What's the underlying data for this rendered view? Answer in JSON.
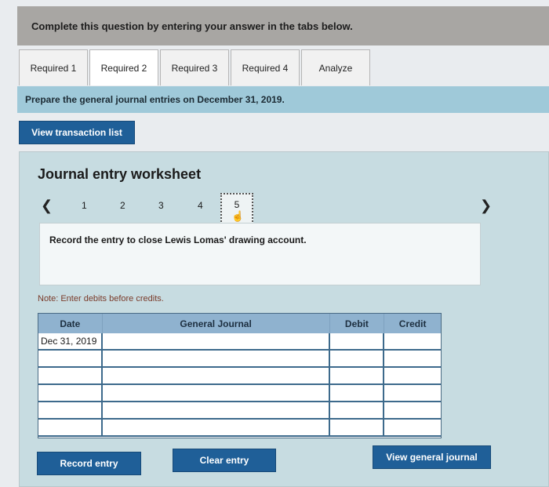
{
  "banner": {
    "text": "Complete this question by entering your answer in the tabs below."
  },
  "tabs": [
    {
      "label": "Required 1",
      "active": false
    },
    {
      "label": "Required 2",
      "active": true
    },
    {
      "label": "Required 3",
      "active": false
    },
    {
      "label": "Required 4",
      "active": false
    },
    {
      "label": "Analyze",
      "active": false
    }
  ],
  "instruction": "Prepare the general journal entries on December 31, 2019.",
  "buttons": {
    "view_transactions": "View transaction list",
    "record": "Record entry",
    "clear": "Clear entry",
    "view_journal": "View general journal"
  },
  "worksheet": {
    "title": "Journal entry worksheet",
    "prev_icon": "chevron-left-icon",
    "next_icon": "chevron-right-icon",
    "pages": [
      "1",
      "2",
      "3",
      "4",
      "5"
    ],
    "active_page": "5",
    "entry_prompt": "Record the entry to close Lewis Lomas' drawing account.",
    "note": "Note: Enter debits before credits."
  },
  "journal": {
    "headers": {
      "date": "Date",
      "account": "General Journal",
      "debit": "Debit",
      "credit": "Credit"
    },
    "rows": [
      {
        "date": "Dec 31, 2019",
        "account": "",
        "debit": "",
        "credit": ""
      },
      {
        "date": "",
        "account": "",
        "debit": "",
        "credit": ""
      },
      {
        "date": "",
        "account": "",
        "debit": "",
        "credit": ""
      },
      {
        "date": "",
        "account": "",
        "debit": "",
        "credit": ""
      },
      {
        "date": "",
        "account": "",
        "debit": "",
        "credit": ""
      },
      {
        "date": "",
        "account": "",
        "debit": "",
        "credit": ""
      }
    ]
  },
  "colors": {
    "accent": "#1f5f98",
    "banner": "#a8a6a3",
    "instruction_bar": "#9fc9d9"
  }
}
